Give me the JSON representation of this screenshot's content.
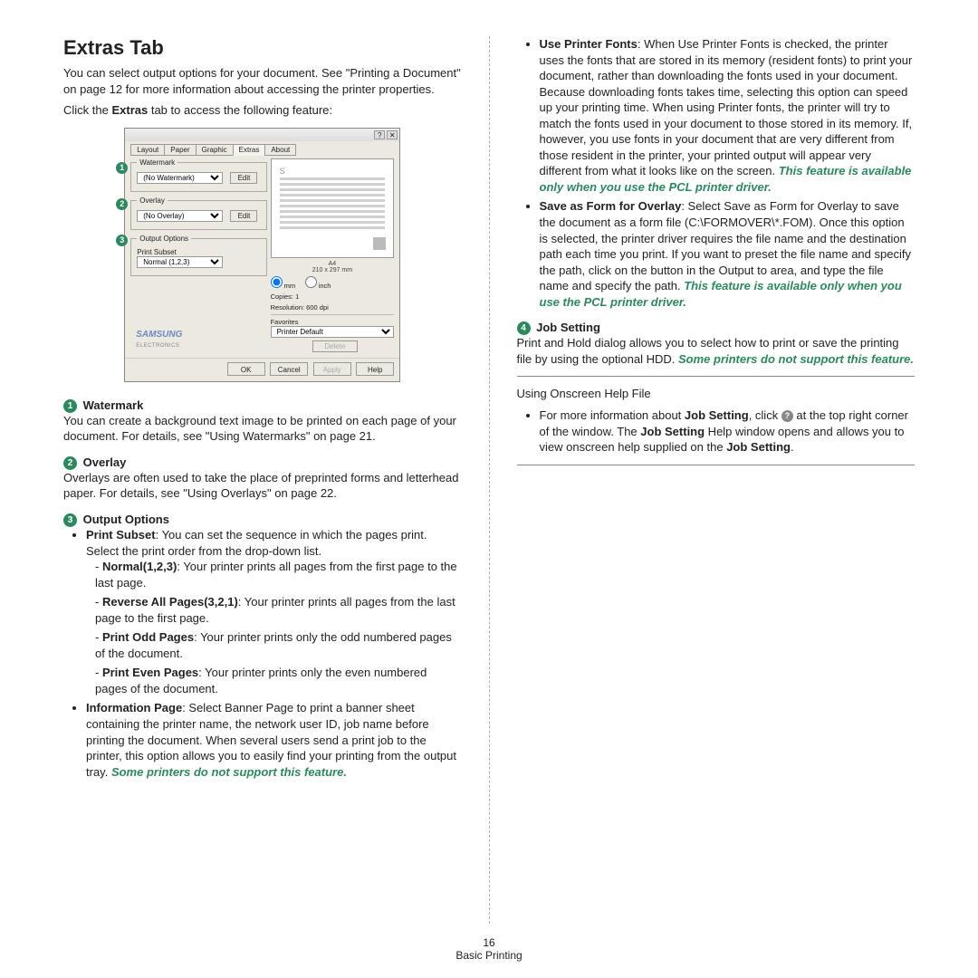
{
  "title": "Extras Tab",
  "intro1": "You can select output options for your document. See \"Printing a Document\" on page 12 for more information about accessing the printer properties.",
  "intro2_pre": "Click the ",
  "intro2_bold": "Extras",
  "intro2_post": " tab to access the following feature:",
  "dialog": {
    "tabs": [
      "Layout",
      "Paper",
      "Graphic",
      "Extras",
      "About"
    ],
    "watermark_legend": "Watermark",
    "watermark_value": "(No Watermark)",
    "overlay_legend": "Overlay",
    "overlay_value": "(No Overlay)",
    "output_legend": "Output Options",
    "output_label": "Print Subset",
    "output_value": "Normal (1,2,3)",
    "edit": "Edit",
    "paper_dim_a": "A4",
    "paper_dim_b": "210 x 297 mm",
    "units_mm": "mm",
    "units_inch": "inch",
    "copies": "Copies: 1",
    "res": "Resolution: 600 dpi",
    "fav": "Favorites",
    "fav_val": "Printer Default",
    "delete": "Delete",
    "brand": "SAMSUNG",
    "brand2": "ELECTRONICS",
    "btns": [
      "OK",
      "Cancel",
      "Apply",
      "Help"
    ]
  },
  "s1": {
    "n": "1",
    "title": "Watermark",
    "body": "You can create a background text image to be printed on each page of your document. For details, see \"Using Watermarks\" on page 21."
  },
  "s2": {
    "n": "2",
    "title": "Overlay",
    "body": "Overlays are often used to take the place of preprinted forms and letterhead paper. For details, see \"Using Overlays\" on page 22."
  },
  "s3": {
    "n": "3",
    "title": "Output Options",
    "ps_b": "Print Subset",
    "ps_t": ": You can set the sequence in which the pages print. Select the print order from the drop-down list.",
    "d1_b": "Normal(1,2,3)",
    "d1_t": ": Your printer prints all pages from the first page to the last page.",
    "d2_b": "Reverse All Pages(3,2,1)",
    "d2_t": ": Your printer prints all pages from the last page to the first page.",
    "d3_b": "Print Odd Pages",
    "d3_t": ": Your printer prints only the odd numbered pages of the document.",
    "d4_b": "Print Even Pages",
    "d4_t": ": Your printer prints only the even numbered pages of the document.",
    "info_b": "Information Page",
    "info_t": ": Select Banner Page to print a banner sheet containing the printer name, the network user ID, job name before printing the document. When several users send a print job to the printer, this option allows you to easily find your printing from the output tray. ",
    "info_g": "Some printers do not support this feature."
  },
  "r1": {
    "b": "Use Printer Fonts",
    "t": ": When Use Printer Fonts is checked, the printer uses the fonts that are stored in its memory (resident fonts) to print your document, rather than downloading the fonts used in your document. Because downloading fonts takes time, selecting this option can speed up your printing time. When using Printer fonts, the printer will try to match the fonts used in your document to those stored in its memory. If, however, you use fonts in your document that are very different from those resident in the printer, your printed output will appear very different from what it looks like on the screen. ",
    "g": "This feature is available only when you use the PCL printer driver."
  },
  "r2": {
    "b": "Save as Form for Overlay",
    "t": ": Select Save as Form for Overlay to save the document as a form file (C:\\FORMOVER\\*.FOM). Once this option is selected, the printer driver requires the file name and the destination path each time you print. If you want to preset the file name and specify the path, click on the button in the Output to area, and type the file name and specify the path. ",
    "g": "This feature is available only when you use the PCL printer driver."
  },
  "s4": {
    "n": "4",
    "title": "Job Setting",
    "body1": "Print and Hold dialog allows you to select how to print or save the printing file by using the optional HDD. ",
    "g": "Some printers do not support this feature."
  },
  "help": {
    "title": "Using Onscreen Help File",
    "pre": "For more information about ",
    "b1": "Job Setting",
    "mid1": ", click ",
    "mid2": " at the top right corner of the window. The ",
    "b2": "Job Setting",
    "mid3": " Help window opens and allows you to view onscreen help supplied on the ",
    "b3": "Job Setting",
    "end": "."
  },
  "footer_num": "16",
  "footer_txt": "Basic Printing"
}
